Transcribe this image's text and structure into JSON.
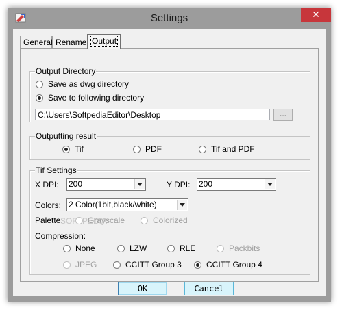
{
  "window": {
    "title": "Settings",
    "close_glyph": "✕"
  },
  "tabs": [
    {
      "label": "General"
    },
    {
      "label": "Rename"
    },
    {
      "label": "Output"
    }
  ],
  "output_directory": {
    "label": "Output Directory",
    "options": [
      "Save as dwg directory",
      "Save to following directory"
    ],
    "selected": "Save to following directory",
    "path_value": "C:\\Users\\SoftpediaEditor\\Desktop",
    "browse_label": "..."
  },
  "outputting_result": {
    "label": "Outputting result",
    "options": [
      "Tif",
      "PDF",
      "Tif and PDF"
    ],
    "selected": "Tif"
  },
  "tif_settings": {
    "label": "Tif Settings",
    "xdpi_label": "X DPI:",
    "xdpi_value": "200",
    "ydpi_label": "Y DPI:",
    "ydpi_value": "200",
    "colors_label": "Colors:",
    "colors_value": "2 Color(1bit,black/white)",
    "palette_label": "Palette:",
    "palette_options": [
      "Grayscale",
      "Colorized"
    ],
    "compression_label": "Compression:",
    "compression_options": [
      "None",
      "LZW",
      "RLE",
      "Packbits",
      "JPEG",
      "CCITT Group 3",
      "CCITT Group 4"
    ],
    "compression_selected": "CCITT Group 4"
  },
  "watermark": "SOFTPEDIA",
  "buttons": {
    "ok": "OK",
    "cancel": "Cancel"
  },
  "colors": {
    "close_red": "#c7363b",
    "button_face": "#d8f4fb"
  }
}
